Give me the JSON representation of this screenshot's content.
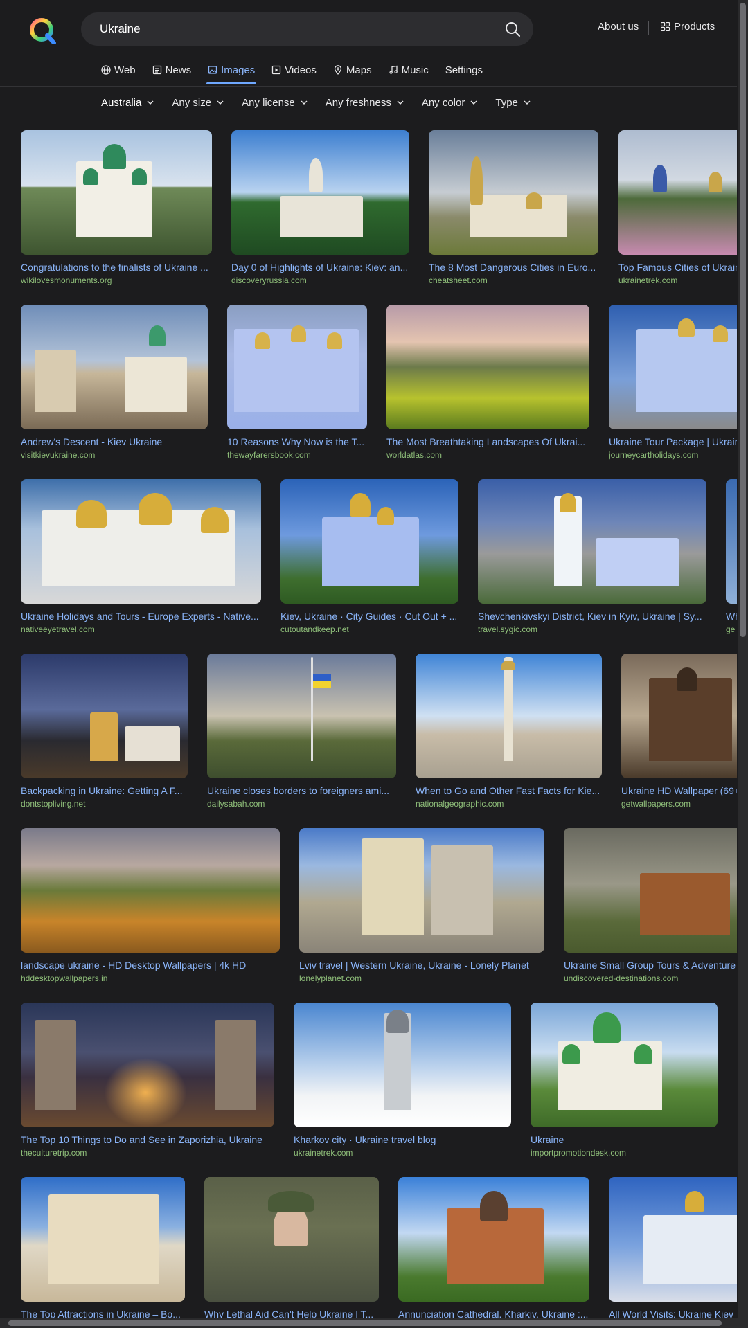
{
  "header": {
    "logo_icon": "qwant-logo-icon",
    "search": {
      "value": "Ukraine",
      "placeholder": "",
      "icon": "search-icon"
    },
    "about_label": "About us",
    "products_label": "Products",
    "products_icon": "grid-icon"
  },
  "nav": {
    "tabs": [
      {
        "label": "Web",
        "icon": "globe-icon"
      },
      {
        "label": "News",
        "icon": "newspaper-icon"
      },
      {
        "label": "Images",
        "icon": "image-icon",
        "active": true
      },
      {
        "label": "Videos",
        "icon": "play-icon"
      },
      {
        "label": "Maps",
        "icon": "map-pin-icon"
      },
      {
        "label": "Music",
        "icon": "music-note-icon"
      },
      {
        "label": "Settings",
        "icon": ""
      }
    ]
  },
  "filters": [
    {
      "label": "Australia"
    },
    {
      "label": "Any size"
    },
    {
      "label": "Any license"
    },
    {
      "label": "Any freshness"
    },
    {
      "label": "Any color"
    },
    {
      "label": "Type"
    }
  ],
  "colors": {
    "background": "#1c1c1e",
    "search_bg": "#2d2d30",
    "link": "#8ab4f8",
    "source": "#8fbf7a",
    "active_tab_underline": "#6fa8ff"
  },
  "results": [
    [
      {
        "title": "Congratulations to the finalists of Ukraine ...",
        "source": "wikilovesmonuments.org"
      },
      {
        "title": "Day 0 of Highlights of Ukraine: Kiev: an...",
        "source": "discoveryrussia.com"
      },
      {
        "title": "The 8 Most Dangerous Cities in Euro...",
        "source": "cheatsheet.com"
      },
      {
        "title": "Top Famous Cities of Ukraine",
        "source": "ukrainetrek.com"
      }
    ],
    [
      {
        "title": "Andrew's Descent - Kiev Ukraine",
        "source": "visitkievukraine.com"
      },
      {
        "title": "10 Reasons Why Now is the T...",
        "source": "thewayfarersbook.com"
      },
      {
        "title": "The Most Breathtaking Landscapes Of Ukrai...",
        "source": "worldatlas.com"
      },
      {
        "title": "Ukraine Tour Package | Ukraine",
        "source": "journeycartholidays.com"
      }
    ],
    [
      {
        "title": "Ukraine Holidays and Tours - Europe Experts - Native...",
        "source": "nativeeyetravel.com"
      },
      {
        "title": "Kiev, Ukraine · City Guides · Cut Out + ...",
        "source": "cutoutandkeep.net"
      },
      {
        "title": "Shevchenkivskyi District, Kiev in Kyiv, Ukraine | Sy...",
        "source": "travel.sygic.com"
      },
      {
        "title": "Wh",
        "source": "ge"
      }
    ],
    [
      {
        "title": "Backpacking in Ukraine: Getting A F...",
        "source": "dontstopliving.net"
      },
      {
        "title": "Ukraine closes borders to foreigners ami...",
        "source": "dailysabah.com"
      },
      {
        "title": "When to Go and Other Fast Facts for Kie...",
        "source": "nationalgeographic.com"
      },
      {
        "title": "Ukraine HD Wallpaper (69+",
        "source": "getwallpapers.com"
      }
    ],
    [
      {
        "title": "landscape ukraine - HD Desktop Wallpapers | 4k HD",
        "source": "hddesktopwallpapers.in"
      },
      {
        "title": "Lviv travel | Western Ukraine, Ukraine - Lonely Planet",
        "source": "lonelyplanet.com"
      },
      {
        "title": "Ukraine Small Group Tours & Adventure",
        "source": "undiscovered-destinations.com"
      }
    ],
    [
      {
        "title": "The Top 10 Things to Do and See in Zaporizhia, Ukraine",
        "source": "theculturetrip.com"
      },
      {
        "title": "Kharkov city · Ukraine travel blog",
        "source": "ukrainetrek.com"
      },
      {
        "title": "Ukraine",
        "source": "importpromotiondesk.com"
      }
    ],
    [
      {
        "title": "The Top Attractions in Ukraine – Bo...",
        "source": ""
      },
      {
        "title": "Why Lethal Aid Can't Help Ukraine | T...",
        "source": ""
      },
      {
        "title": "Annunciation Cathedral, Kharkiv, Ukraine :...",
        "source": ""
      },
      {
        "title": "All World Visits: Ukraine Kiev",
        "source": ""
      }
    ]
  ]
}
